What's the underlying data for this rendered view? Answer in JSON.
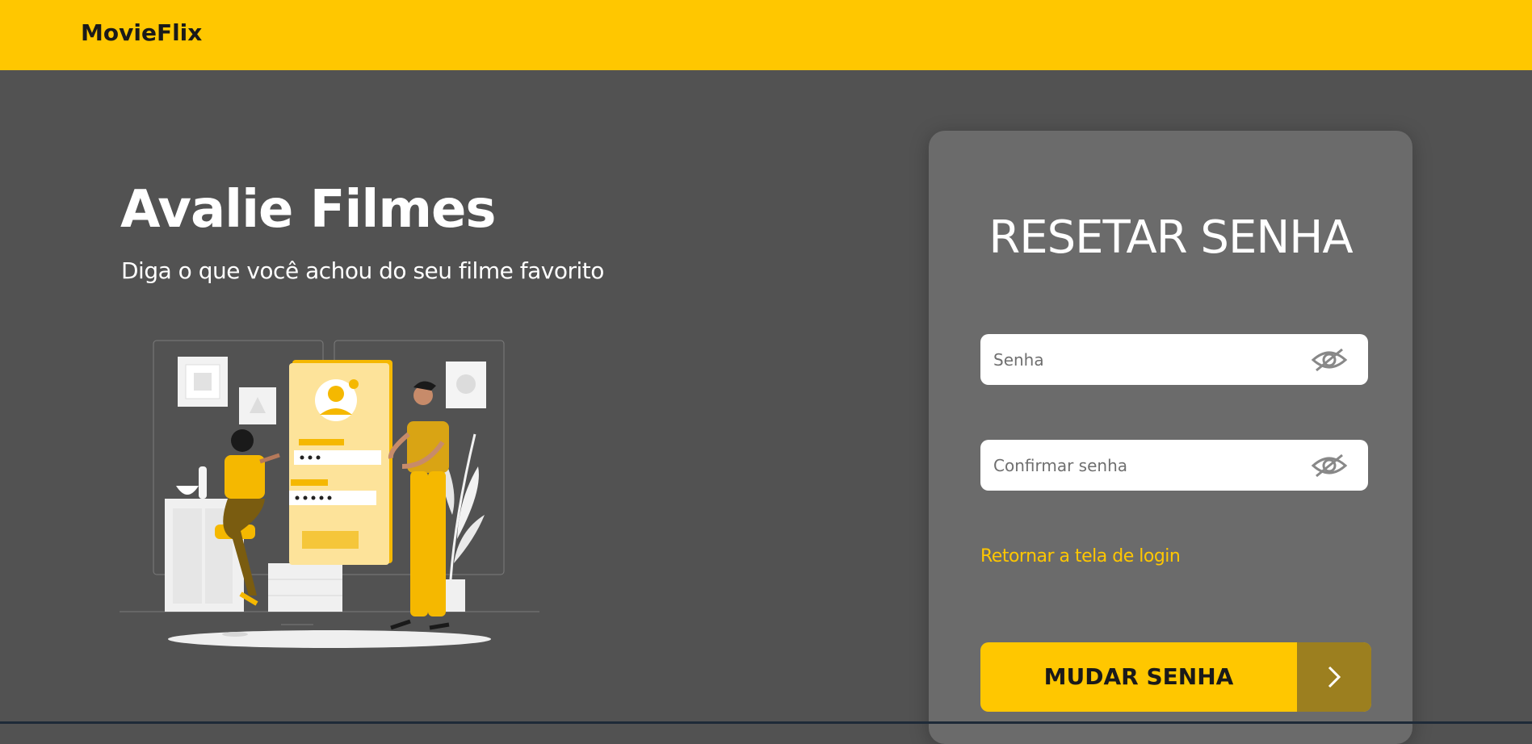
{
  "navbar": {
    "brand": "MovieFlix"
  },
  "hero": {
    "title": "Avalie Filmes",
    "subtitle": "Diga o que você achou do seu filme favorito",
    "illustration_icon": "login-form-illustration"
  },
  "reset_card": {
    "title": "RESETAR SENHA",
    "password_field": {
      "value": "",
      "placeholder": "Senha",
      "toggle_icon": "eye-slash-icon"
    },
    "confirm_field": {
      "value": "",
      "placeholder": "Confirmar senha",
      "toggle_icon": "eye-slash-icon"
    },
    "back_link": "Retornar a tela de login",
    "submit_label": "MUDAR SENHA",
    "submit_icon": "chevron-right-icon"
  },
  "colors": {
    "accent": "#FFC700",
    "background": "#525252",
    "card": "#6B6B6B",
    "button_arrow_bg": "#9C7F1F",
    "text_light": "#FFFFFF",
    "text_dark": "#1A1A1A"
  }
}
